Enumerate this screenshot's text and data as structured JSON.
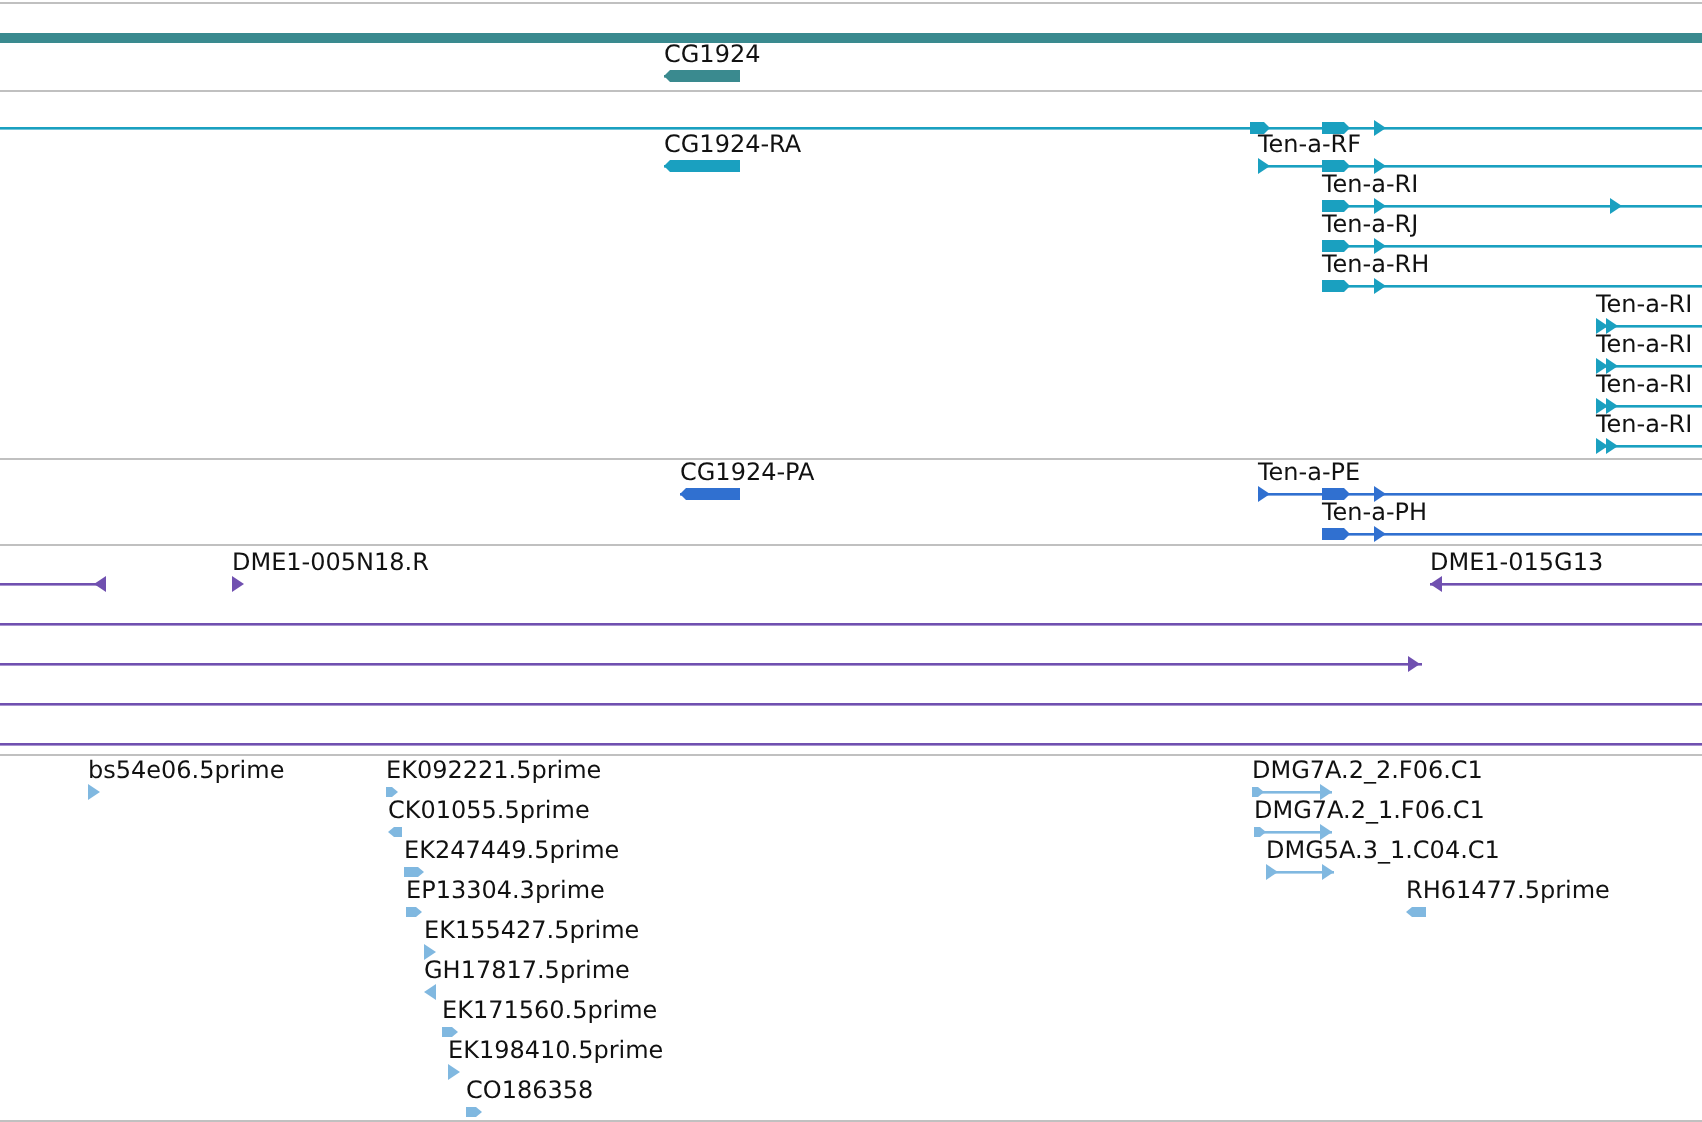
{
  "tracks": [
    {
      "kind": "genes",
      "color": "#3a8a8f",
      "features": [
        {
          "kind": "bar"
        },
        {
          "kind": "feature",
          "label": "CG1924",
          "reverse": true
        }
      ]
    },
    {
      "kind": "transcripts",
      "color": "#1aa0c0",
      "features": [
        {
          "kind": "feature",
          "reverse": false
        },
        {
          "kind": "feature",
          "label": "CG1924-RA",
          "reverse": true
        },
        {
          "kind": "feature",
          "label": "Ten-a-RF",
          "reverse": false
        },
        {
          "kind": "feature",
          "label": "Ten-a-RI",
          "reverse": false
        },
        {
          "kind": "feature",
          "label": "Ten-a-RJ",
          "reverse": false
        },
        {
          "kind": "feature",
          "label": "Ten-a-RH",
          "reverse": false
        },
        {
          "kind": "feature",
          "label": "Ten-a-RI",
          "reverse": false
        },
        {
          "kind": "feature",
          "label": "Ten-a-RI",
          "reverse": false
        },
        {
          "kind": "feature",
          "label": "Ten-a-RI",
          "reverse": false
        },
        {
          "kind": "feature",
          "label": "Ten-a-RI",
          "reverse": false
        }
      ]
    },
    {
      "kind": "proteins",
      "color": "#3070d0",
      "features": [
        {
          "kind": "feature",
          "label": "CG1924-PA",
          "reverse": true
        },
        {
          "kind": "feature",
          "label": "Ten-a-PE",
          "reverse": false
        },
        {
          "kind": "feature",
          "label": "Ten-a-PH",
          "reverse": false
        }
      ]
    },
    {
      "kind": "clones",
      "color": "#7050b0",
      "features": [
        {
          "kind": "feature",
          "reverse": true
        },
        {
          "kind": "feature",
          "label": "DME1-005N18.R",
          "reverse": false
        },
        {
          "kind": "feature",
          "label": "DME1-015G13",
          "reverse": true
        },
        {
          "kind": "line"
        },
        {
          "kind": "feature",
          "reverse": false
        },
        {
          "kind": "line"
        },
        {
          "kind": "line"
        }
      ]
    },
    {
      "kind": "ests",
      "color": "#80b8e0",
      "features": [
        {
          "kind": "feature",
          "label": "bs54e06.5prime",
          "reverse": false
        },
        {
          "kind": "feature",
          "label": "EK092221.5prime",
          "reverse": false
        },
        {
          "kind": "feature",
          "label": "CK01055.5prime",
          "reverse": true
        },
        {
          "kind": "feature",
          "label": "EK247449.5prime",
          "reverse": false
        },
        {
          "kind": "feature",
          "label": "EP13304.3prime",
          "reverse": false
        },
        {
          "kind": "feature",
          "label": "EK155427.5prime",
          "reverse": false
        },
        {
          "kind": "feature",
          "label": "GH17817.5prime",
          "reverse": true
        },
        {
          "kind": "feature",
          "label": "EK171560.5prime",
          "reverse": false
        },
        {
          "kind": "feature",
          "label": "EK198410.5prime",
          "reverse": false
        },
        {
          "kind": "feature",
          "label": "CO186358",
          "reverse": false
        },
        {
          "kind": "feature",
          "label": "DMG7A.2_2.F06.C1",
          "reverse": false
        },
        {
          "kind": "feature",
          "label": "DMG7A.2_1.F06.C1",
          "reverse": false
        },
        {
          "kind": "feature",
          "label": "DMG5A.3_1.C04.C1",
          "reverse": false
        },
        {
          "kind": "feature",
          "label": "RH61477.5prime",
          "reverse": true
        }
      ]
    }
  ]
}
